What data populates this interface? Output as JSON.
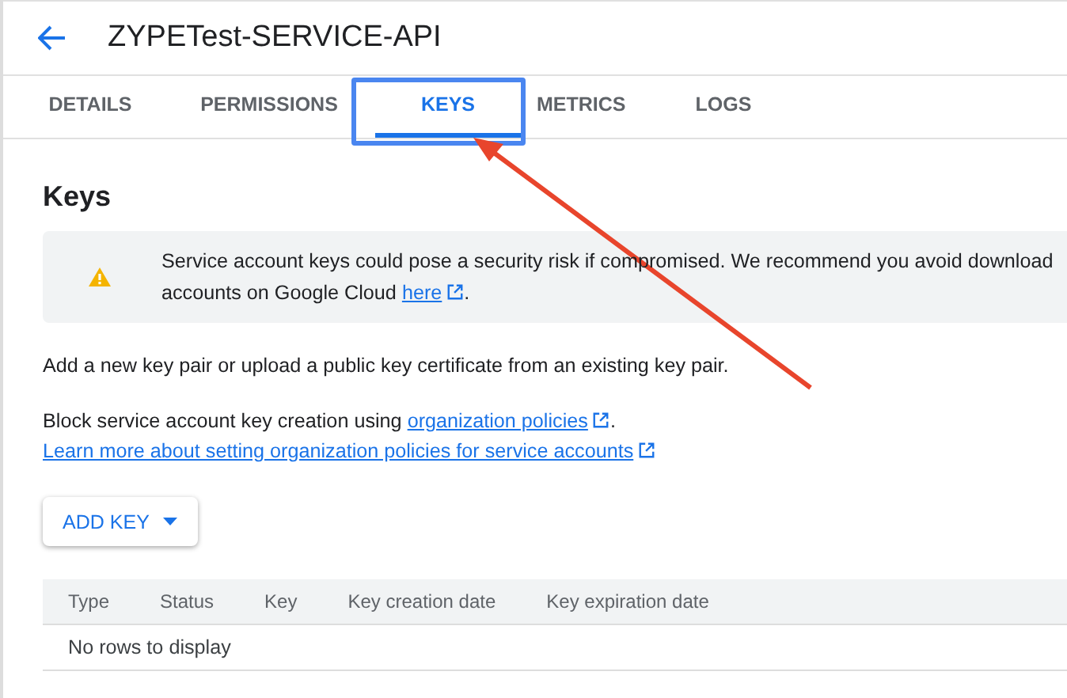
{
  "header": {
    "title": "ZYPETest-SERVICE-API"
  },
  "tabs": [
    {
      "label": "DETAILS",
      "selected": false
    },
    {
      "label": "PERMISSIONS",
      "selected": false
    },
    {
      "label": "KEYS",
      "selected": true
    },
    {
      "label": "METRICS",
      "selected": false
    },
    {
      "label": "LOGS",
      "selected": false
    }
  ],
  "section_title": "Keys",
  "warning": {
    "line_1": "Service account keys could pose a security risk if compromised. We recommend you avoid download",
    "line_2": "accounts on Google Cloud",
    "link": "here",
    "after": "."
  },
  "intro": "Add a new key pair or upload a public key certificate from an existing key pair.",
  "policy": {
    "text": "Block service account key creation using",
    "link": "organization policies",
    "after": "."
  },
  "learn_more": "Learn more about setting organization policies for service accounts",
  "add_key_button": "ADD KEY",
  "table": {
    "columns": [
      "Type",
      "Status",
      "Key",
      "Key creation date",
      "Key expiration date"
    ],
    "empty_message": "No rows to display"
  }
}
